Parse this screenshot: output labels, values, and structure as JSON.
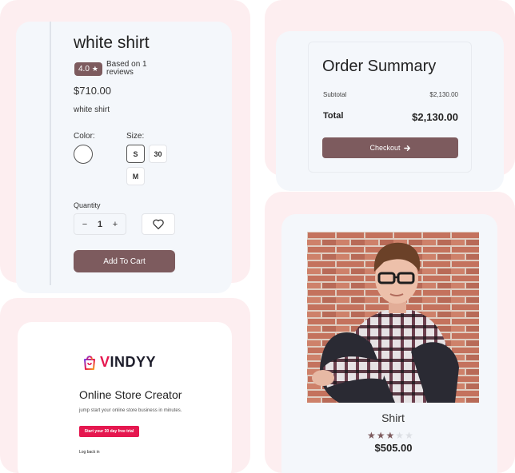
{
  "product_detail": {
    "title": "white shirt",
    "rating": "4.0",
    "rating_text": "Based on 1 reviews",
    "price": "$710.00",
    "description": "white shirt",
    "color_label": "Color:",
    "size_label": "Size:",
    "sizes": [
      "S",
      "30",
      "M"
    ],
    "selected_size": "S",
    "quantity_label": "Quantity",
    "quantity": "1",
    "qty_minus": "−",
    "qty_plus": "+",
    "add_to_cart": "Add To Cart",
    "colors": {
      "accent": "#7d5b5e",
      "tile": "#fdeef0",
      "card": "#f4f7fb"
    }
  },
  "order_summary": {
    "title": "Order Summary",
    "subtotal_label": "Subtotal",
    "subtotal_value": "$2,130.00",
    "total_label": "Total",
    "total_value": "$2,130.00",
    "checkout_label": "Checkout",
    "checkout_icon": "arrow-right-icon"
  },
  "vindyy": {
    "logo_text": "VINDYY",
    "logo_icon": "shopping-bag-icon",
    "headline": "Online Store Creator",
    "subheadline": "jump start your online store business in minutes.",
    "cta_label": "Start your 30 day free trial",
    "login_label": "Log back in",
    "brand_color": "#e5174f"
  },
  "shirt_product": {
    "name": "Shirt",
    "rating_stars": 3,
    "max_stars": 5,
    "price": "$505.00",
    "image_subject": "young man in glasses and plaid shirt sitting against brick wall"
  }
}
